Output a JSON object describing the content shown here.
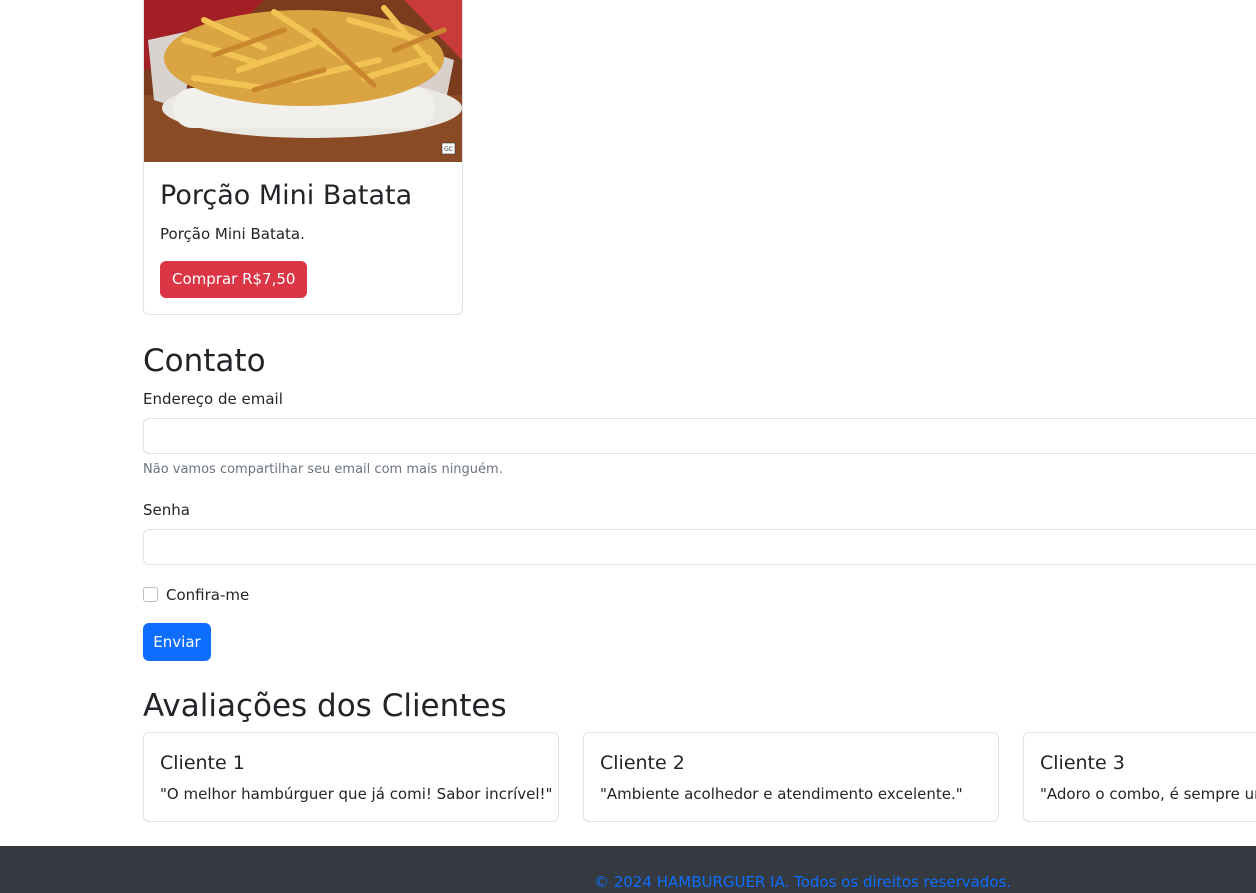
{
  "product": {
    "title": "Porção Mini Batata",
    "description": "Porção Mini Batata.",
    "buy_label": "Comprar R$7,50",
    "image_badge": "GC"
  },
  "contact": {
    "title": "Contato",
    "email_label": "Endereço de email",
    "email_value": "",
    "email_help": "Não vamos compartilhar seu email com mais ninguém.",
    "password_label": "Senha",
    "password_value": "",
    "checkbox_label": "Confira-me",
    "submit_label": "Enviar"
  },
  "reviews": {
    "title": "Avaliações dos Clientes",
    "items": [
      {
        "name": "Cliente 1",
        "text": "\"O melhor hambúrguer que já comi! Sabor incrível!\""
      },
      {
        "name": "Cliente 2",
        "text": "\"Ambiente acolhedor e atendimento excelente.\""
      },
      {
        "name": "Cliente 3",
        "text": "\"Adoro o combo, é sempre um"
      }
    ]
  },
  "footer": {
    "text": "© 2024 HAMBURGUER IA. Todos os direitos reservados."
  },
  "colors": {
    "danger": "#dc3545",
    "primary": "#0d6efd",
    "footer_bg": "#343a40"
  }
}
